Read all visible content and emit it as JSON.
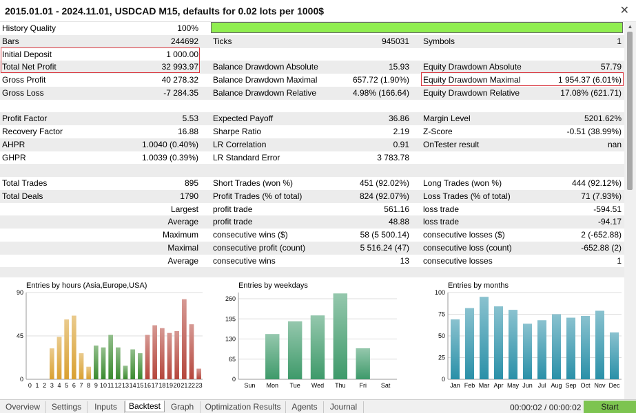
{
  "window": {
    "title": "2015.01.01 - 2024.11.01, USDCAD M15, defaults for 0.02 lots per 1000$",
    "close_icon": "close-icon"
  },
  "rows": [
    {
      "shade": false,
      "c": [
        "History Quality",
        "100%",
        "",
        "",
        "",
        ""
      ],
      "bar": true
    },
    {
      "shade": true,
      "c": [
        "Bars",
        "244692",
        "Ticks",
        "945031",
        "Symbols",
        "1"
      ]
    },
    {
      "shade": false,
      "c": [
        "Initial Deposit",
        "1 000.00",
        "",
        "",
        "",
        ""
      ]
    },
    {
      "shade": true,
      "c": [
        "Total Net Profit",
        "32 993.97",
        "Balance Drawdown Absolute",
        "15.93",
        "Equity Drawdown Absolute",
        "57.79"
      ]
    },
    {
      "shade": false,
      "c": [
        "Gross Profit",
        "40 278.32",
        "Balance Drawdown Maximal",
        "657.72 (1.90%)",
        "Equity Drawdown Maximal",
        "1 954.37 (6.01%)"
      ]
    },
    {
      "shade": true,
      "c": [
        "Gross Loss",
        "-7 284.35",
        "Balance Drawdown Relative",
        "4.98% (166.64)",
        "Equity Drawdown Relative",
        "17.08% (621.71)"
      ]
    },
    {
      "shade": false,
      "c": [
        "",
        "",
        "",
        "",
        "",
        ""
      ]
    },
    {
      "shade": true,
      "c": [
        "Profit Factor",
        "5.53",
        "Expected Payoff",
        "36.86",
        "Margin Level",
        "5201.62%"
      ]
    },
    {
      "shade": false,
      "c": [
        "Recovery Factor",
        "16.88",
        "Sharpe Ratio",
        "2.19",
        "Z-Score",
        "-0.51 (38.99%)"
      ]
    },
    {
      "shade": true,
      "c": [
        "AHPR",
        "1.0040 (0.40%)",
        "LR Correlation",
        "0.91",
        "OnTester result",
        "nan"
      ]
    },
    {
      "shade": false,
      "c": [
        "GHPR",
        "1.0039 (0.39%)",
        "LR Standard Error",
        "3 783.78",
        "",
        ""
      ]
    },
    {
      "shade": true,
      "c": [
        "",
        "",
        "",
        "",
        "",
        ""
      ]
    },
    {
      "shade": false,
      "c": [
        "Total Trades",
        "895",
        "Short Trades (won %)",
        "451 (92.02%)",
        "Long Trades (won %)",
        "444 (92.12%)"
      ]
    },
    {
      "shade": true,
      "c": [
        "Total Deals",
        "1790",
        "Profit Trades (% of total)",
        "824 (92.07%)",
        "Loss Trades (% of total)",
        "71 (7.93%)"
      ]
    },
    {
      "shade": false,
      "c": [
        "Largest",
        "",
        "profit trade",
        "561.16",
        "loss trade",
        "-594.51"
      ],
      "right_label": true
    },
    {
      "shade": true,
      "c": [
        "Average",
        "",
        "profit trade",
        "48.88",
        "loss trade",
        "-94.17"
      ],
      "right_label": true
    },
    {
      "shade": false,
      "c": [
        "Maximum",
        "",
        "consecutive wins ($)",
        "58 (5 500.14)",
        "consecutive losses ($)",
        "2 (-652.88)"
      ],
      "right_label": true
    },
    {
      "shade": true,
      "c": [
        "Maximal",
        "",
        "consecutive profit (count)",
        "5 516.24 (47)",
        "consecutive loss (count)",
        "-652.88 (2)"
      ],
      "right_label": true
    },
    {
      "shade": false,
      "c": [
        "Average",
        "",
        "consecutive wins",
        "13",
        "consecutive losses",
        "1"
      ],
      "right_label": true
    },
    {
      "shade": true,
      "c": [
        "",
        "",
        "",
        "",
        "",
        ""
      ]
    }
  ],
  "chart_data": [
    {
      "type": "bar",
      "title": "Entries by hours (Asia,Europe,USA)",
      "categories": [
        "0",
        "1",
        "2",
        "3",
        "4",
        "5",
        "6",
        "7",
        "8",
        "9",
        "10",
        "11",
        "12",
        "13",
        "14",
        "15",
        "16",
        "17",
        "18",
        "19",
        "20",
        "21",
        "22",
        "23"
      ],
      "values": [
        0,
        0,
        0,
        32,
        44,
        62,
        66,
        27,
        13,
        35,
        33,
        46,
        33,
        14,
        31,
        27,
        46,
        56,
        53,
        48,
        50,
        83,
        57,
        11
      ],
      "ylim": [
        0,
        90
      ],
      "yticks": [
        "0",
        "45",
        "90"
      ],
      "colors": [
        "#d9a030",
        "#d9a030",
        "#d9a030",
        "#d9a030",
        "#d9a030",
        "#d9a030",
        "#d9a030",
        "#d9a030",
        "#d9a030",
        "#3a8a2e",
        "#3a8a2e",
        "#3a8a2e",
        "#3a8a2e",
        "#3a8a2e",
        "#3a8a2e",
        "#3a8a2e",
        "#b5463c",
        "#b5463c",
        "#b5463c",
        "#b5463c",
        "#b5463c",
        "#b5463c",
        "#b5463c",
        "#b5463c"
      ]
    },
    {
      "type": "bar",
      "title": "Entries by weekdays",
      "categories": [
        "Sun",
        "Mon",
        "Tue",
        "Wed",
        "Thu",
        "Fri",
        "Sat"
      ],
      "values": [
        0,
        146,
        187,
        206,
        277,
        100,
        0
      ],
      "ylim": [
        0,
        280
      ],
      "yticks": [
        "0",
        "65",
        "130",
        "195",
        "260"
      ],
      "colors": [
        "#3e9a6a"
      ]
    },
    {
      "type": "bar",
      "title": "Entries by months",
      "categories": [
        "Jan",
        "Feb",
        "Mar",
        "Apr",
        "May",
        "Jun",
        "Jul",
        "Aug",
        "Sep",
        "Oct",
        "Nov",
        "Dec"
      ],
      "values": [
        69,
        82,
        95,
        84,
        80,
        64,
        68,
        75,
        71,
        73,
        79,
        54
      ],
      "ylim": [
        0,
        100
      ],
      "yticks": [
        "0",
        "25",
        "50",
        "75",
        "100"
      ],
      "colors": [
        "#2a90a8"
      ]
    }
  ],
  "tabs": [
    {
      "label": "Overview",
      "active": false
    },
    {
      "label": "Settings",
      "active": false
    },
    {
      "label": "Inputs",
      "active": false
    },
    {
      "label": "Backtest",
      "active": true
    },
    {
      "label": "Graph",
      "active": false
    },
    {
      "label": "Optimization Results",
      "active": false
    },
    {
      "label": "Agents",
      "active": false
    },
    {
      "label": "Journal",
      "active": false
    }
  ],
  "status": {
    "timer": "00:00:02 / 00:00:02",
    "start_label": "Start"
  }
}
